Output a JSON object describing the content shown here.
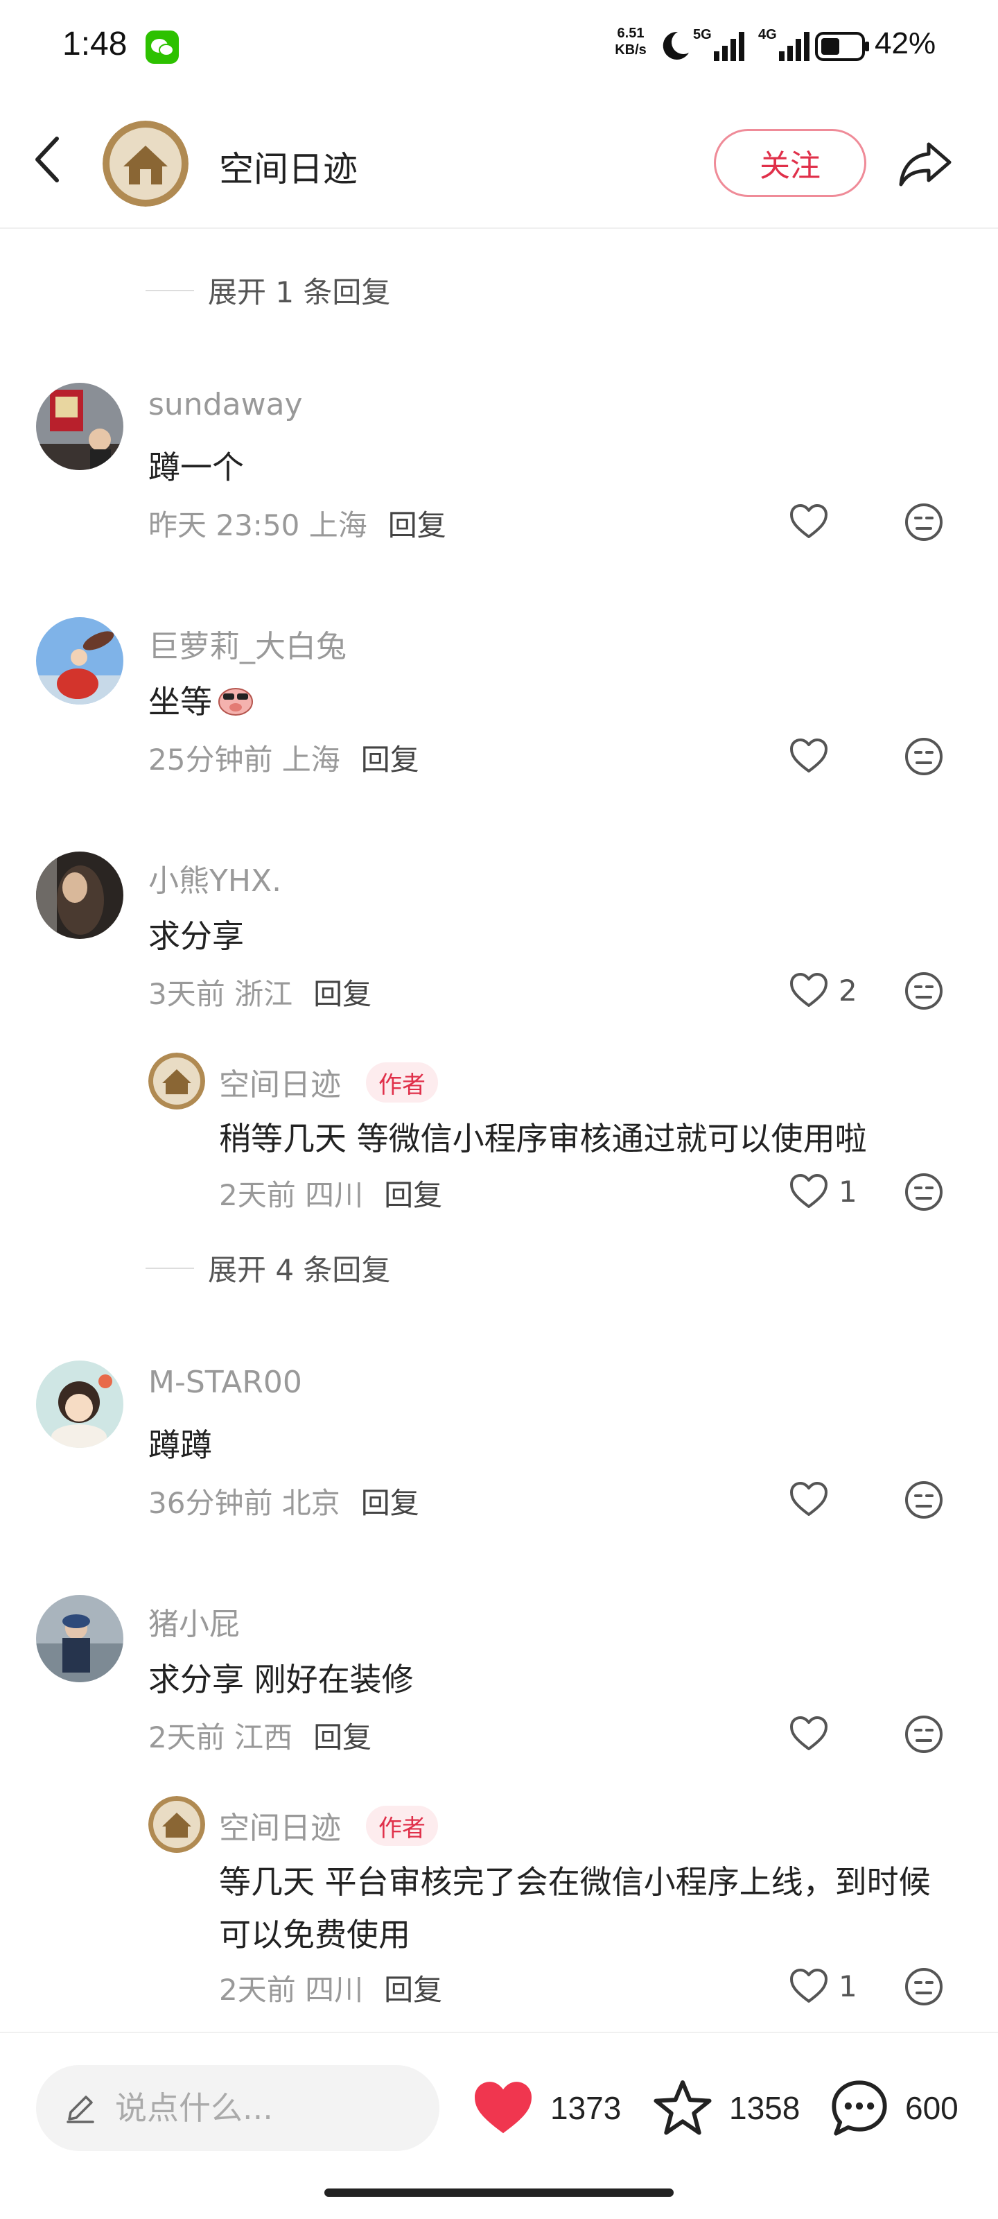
{
  "status_bar": {
    "time": "1:48",
    "net_speed_value": "6.51",
    "net_speed_unit": "KB/s",
    "network_5g": "5G",
    "network_4g": "4G",
    "battery": "42%"
  },
  "header": {
    "title": "空间日迹",
    "follow_label": "关注"
  },
  "expand_top": "展开 1 条回复",
  "comments": [
    {
      "name": "sundaway",
      "text": "蹲一个",
      "time_loc": "昨天 23:50 上海",
      "reply_label": "回复",
      "likes": ""
    },
    {
      "name": "巨萝莉_大白兔",
      "text": "坐等",
      "time_loc": "25分钟前 上海",
      "reply_label": "回复",
      "likes": ""
    },
    {
      "name": "小熊YHX.",
      "text": "求分享",
      "time_loc": "3天前 浙江",
      "reply_label": "回复",
      "likes": "2"
    },
    {
      "name": "M-STAR00",
      "text": "蹲蹲",
      "time_loc": "36分钟前 北京",
      "reply_label": "回复",
      "likes": ""
    },
    {
      "name": "猪小屁",
      "text": "求分享 刚好在装修",
      "time_loc": "2天前 江西",
      "reply_label": "回复",
      "likes": ""
    }
  ],
  "replies": [
    {
      "name": "空间日迹",
      "tag": "作者",
      "text": "稍等几天 等微信小程序审核通过就可以使用啦",
      "time_loc": "2天前 四川",
      "reply_label": "回复",
      "likes": "1"
    },
    {
      "name": "空间日迹",
      "tag": "作者",
      "text": "等几天 平台审核完了会在微信小程序上线，到时候可以免费使用",
      "time_loc": "2天前 四川",
      "reply_label": "回复",
      "likes": "1"
    }
  ],
  "expand_mid": "展开 4 条回复",
  "bottom_bar": {
    "input_placeholder": "说点什么...",
    "likes": "1373",
    "favorites": "1358",
    "comments": "600"
  },
  "colors": {
    "accent_red": "#e0304a",
    "heart_red": "#f0364f",
    "muted_text": "#999999"
  },
  "icons": [
    "back-arrow-icon",
    "share-icon",
    "heart-icon",
    "dislike-face-icon",
    "star-icon",
    "comment-bubble-icon",
    "pencil-icon",
    "moon-icon",
    "wechat-icon",
    "battery-icon"
  ]
}
